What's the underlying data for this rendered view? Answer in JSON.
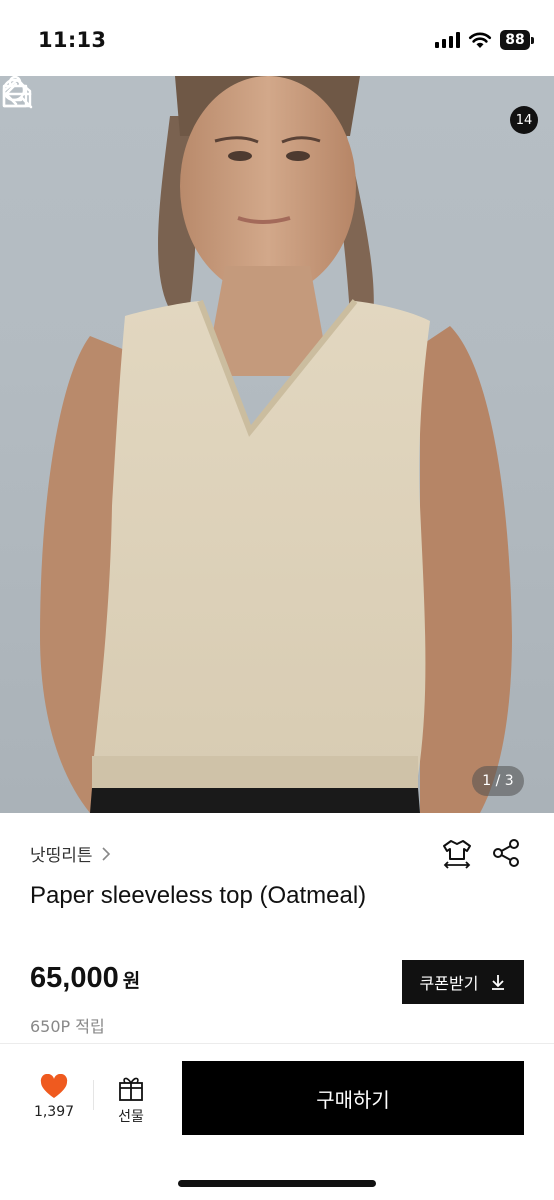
{
  "status_bar": {
    "time": "11:13",
    "battery": "88"
  },
  "header": {
    "cart_count": "14"
  },
  "gallery": {
    "page_indicator": "1 / 3"
  },
  "product": {
    "brand": "낫띵리튼",
    "title": "Paper sleeveless top (Oatmeal)",
    "price": "65,000",
    "currency": "원",
    "points": "650P 적립"
  },
  "coupon": {
    "label": "쿠폰받기"
  },
  "bottom_bar": {
    "like_count": "1,397",
    "gift_label": "선물",
    "buy_label": "구매하기"
  },
  "icons": {
    "back": "back-arrow-icon",
    "home": "home-icon",
    "search": "search-icon",
    "cart": "shopping-bag-icon",
    "size": "size-guide-icon",
    "share": "share-icon",
    "download": "download-icon",
    "heart": "heart-icon",
    "gift": "gift-icon"
  },
  "colors": {
    "heart": "#ef5a1f",
    "buy_button": "#000000"
  }
}
